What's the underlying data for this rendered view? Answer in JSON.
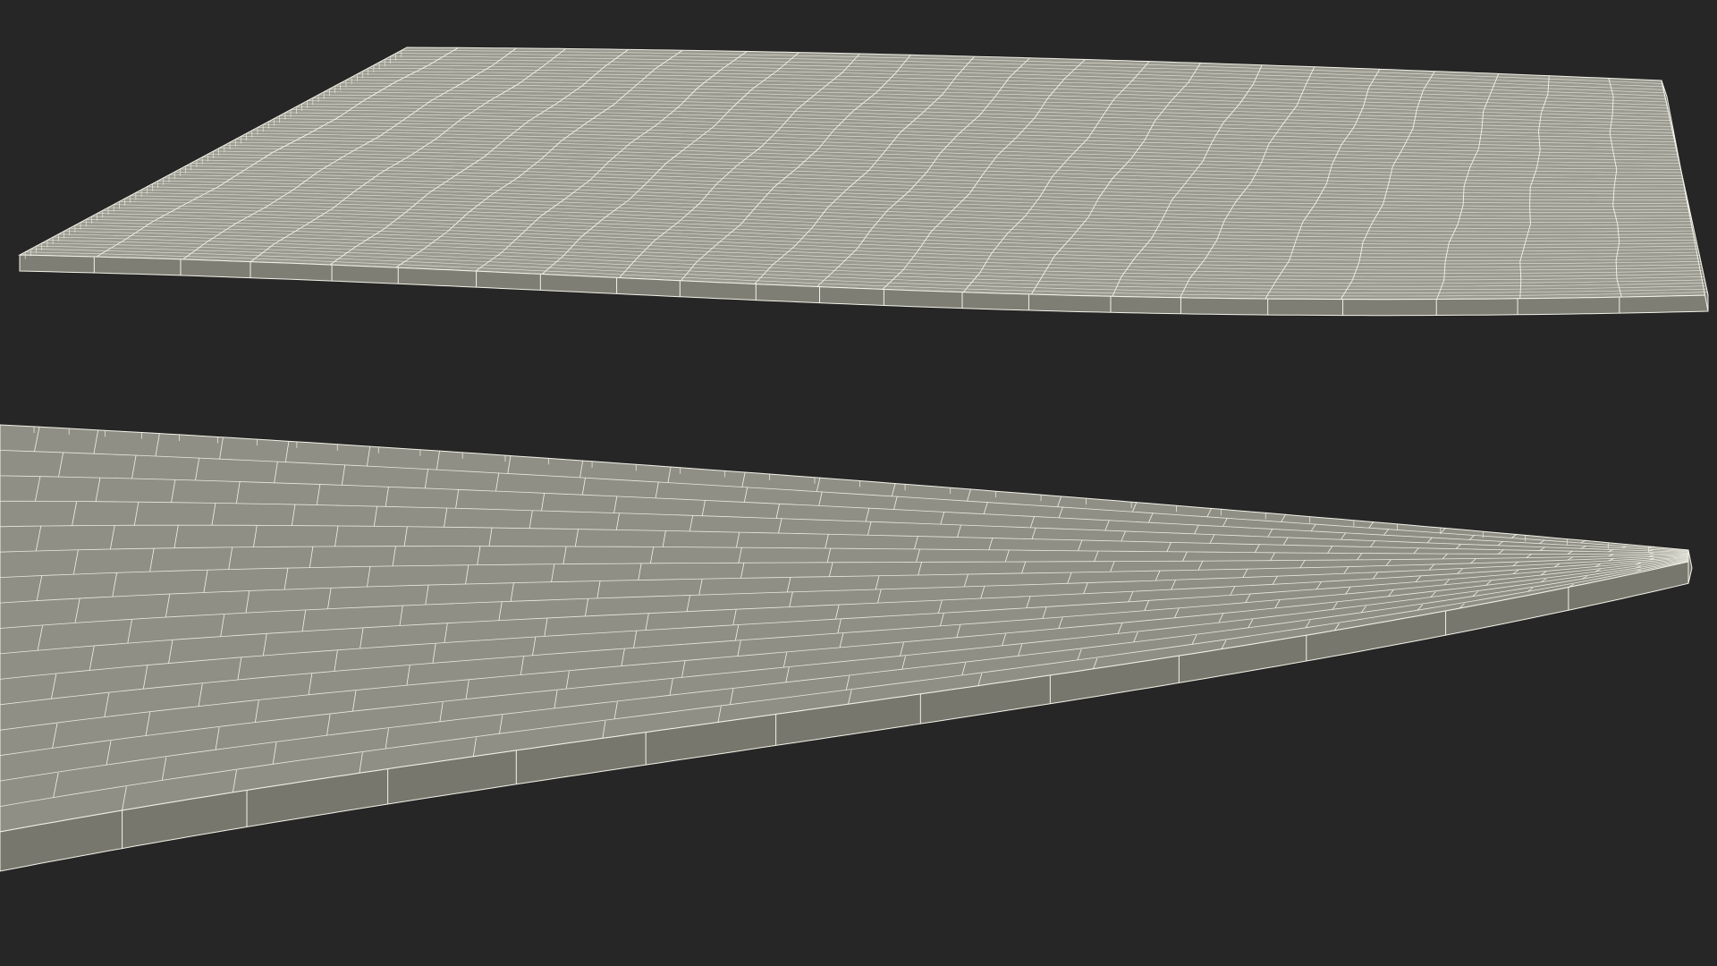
{
  "scene": {
    "background_color": "#262626",
    "render_style": "3D wireframe-on-shaded render",
    "objects": [
      {
        "name": "wavy-plank-panel",
        "surface_color": "#9a9a90",
        "side_color": "#7e7e74",
        "wire_color": "#f2f2e8"
      },
      {
        "name": "curved-brick-paving",
        "surface_color": "#8f8f86",
        "side_color": "#77776d",
        "wire_color": "#f2f2e8"
      }
    ]
  }
}
